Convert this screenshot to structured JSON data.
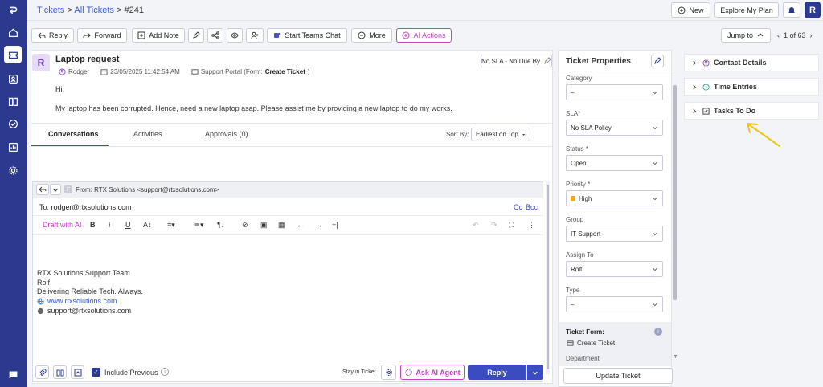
{
  "breadcrumb": {
    "root": "Tickets",
    "sep1": ">",
    "all": "All Tickets",
    "sep2": ">",
    "current": "#241"
  },
  "header": {
    "new_label": "New",
    "plan_label": "Explore My Plan",
    "avatar_initial": "R"
  },
  "toolbar": {
    "reply": "Reply",
    "forward": "Forward",
    "add_note": "Add Note",
    "teams": "Start Teams Chat",
    "more": "More",
    "ai_actions": "AI Actions",
    "jump_to": "Jump to",
    "pagination": "1 of 63"
  },
  "ticket": {
    "initial": "R",
    "subject": "Laptop request",
    "requester": "Rodger",
    "date": "23/05/2025 11:42:54 AM",
    "source_prefix": "Support Portal (Form:",
    "source_form": "Create Ticket",
    "source_suffix": ")",
    "sla_badge": "No SLA - No Due By",
    "greeting": "Hi,",
    "body": "My laptop has been corrupted. Hence, need a new laptop asap. Please assist me by providing a new laptop to do my works."
  },
  "tabs": [
    {
      "label": "Conversations"
    },
    {
      "label": "Activities"
    },
    {
      "label": "Approvals (0)"
    }
  ],
  "sort": {
    "label": "Sort By:",
    "value": "Earliest on Top"
  },
  "composer": {
    "from": "From: RTX Solutions <support@rtxsolutions.com>",
    "from_badge": "F",
    "to": "To: rodger@rtxsolutions.com",
    "cc": "Cc",
    "bcc": "Bcc",
    "draft_ai": "Draft with AI",
    "signature": {
      "team": "RTX Solutions Support Team",
      "name": "Rolf",
      "tagline": "Delivering Reliable Tech. Always.",
      "website": "www.rtxsolutions.com",
      "email": "support@rtxsolutions.com"
    },
    "include_previous": "Include Previous",
    "stay_in_ticket": "Stay in Ticket",
    "ask_ai": "Ask AI Agent",
    "reply": "Reply"
  },
  "properties": {
    "title": "Ticket Properties",
    "fields": [
      {
        "label": "Category",
        "value": "–"
      },
      {
        "label": "SLA*",
        "value": "No SLA Policy"
      },
      {
        "label": "Status *",
        "value": "Open"
      },
      {
        "label": "Priority *",
        "value": "High"
      },
      {
        "label": "Group",
        "value": "IT Support"
      },
      {
        "label": "Assign To",
        "value": "Rolf"
      },
      {
        "label": "Type",
        "value": "–"
      }
    ],
    "form_label": "Ticket Form:",
    "form_value": "Create Ticket",
    "department": "Department",
    "update_button": "Update Ticket",
    "priority_color": "#f5a623"
  },
  "right_panel": {
    "contact": "Contact Details",
    "time": "Time Entries",
    "tasks": "Tasks To Do"
  },
  "colors": {
    "brand": "#2b3a8f",
    "accent": "#3b4cc0",
    "ai": "#c23fbf",
    "arrow": "#f0c419"
  }
}
